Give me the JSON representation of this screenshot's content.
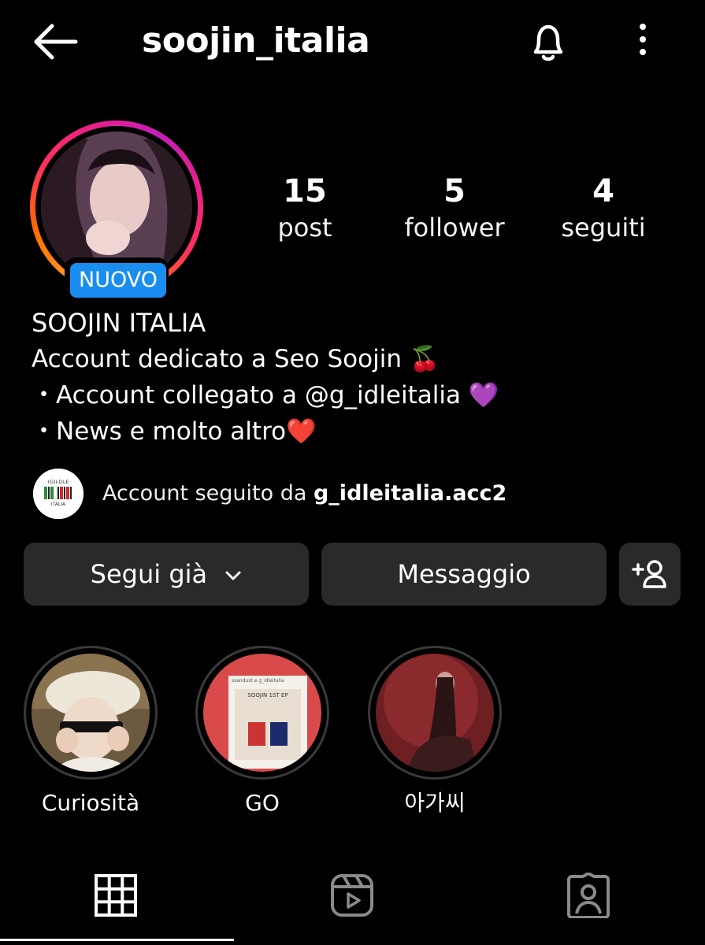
{
  "header": {
    "username": "soojin_italia",
    "icons": {
      "back": "arrow-left-icon",
      "notifications": "bell-icon",
      "more": "more-vertical-icon"
    }
  },
  "profile": {
    "badge": "NUOVO",
    "stats": [
      {
        "value": "15",
        "label": "post"
      },
      {
        "value": "5",
        "label": "follower"
      },
      {
        "value": "4",
        "label": "seguiti"
      }
    ],
    "display_name": "SOOJIN ITALIA",
    "bio": [
      "Account dedicato a Seo Soojin 🍒",
      "・Account collegato a @g_idleitalia 💜",
      "・News e molto altro❤️"
    ],
    "followed_by": {
      "prefix": "Account seguito da ",
      "account": "g_idleitalia.acc2",
      "avatar_text_top": "(G)I-DLE",
      "avatar_text_bottom": "ITALIA"
    }
  },
  "actions": {
    "following": "Segui già",
    "message": "Messaggio"
  },
  "highlights": [
    {
      "label": "Curiosità"
    },
    {
      "label": "GO",
      "card_title": "SOOJIN 1ST EP",
      "card_header": "ssandust e g_idleitalia"
    },
    {
      "label": "아가씨"
    }
  ],
  "tabs": [
    {
      "name": "grid",
      "icon": "grid-icon",
      "active": true
    },
    {
      "name": "reels",
      "icon": "reels-icon",
      "active": false
    },
    {
      "name": "tagged",
      "icon": "tagged-person-icon",
      "active": false
    }
  ],
  "colors": {
    "background": "#000000",
    "button": "#2a2a2a",
    "badge": "#1a8ef0",
    "text": "#ffffff"
  }
}
